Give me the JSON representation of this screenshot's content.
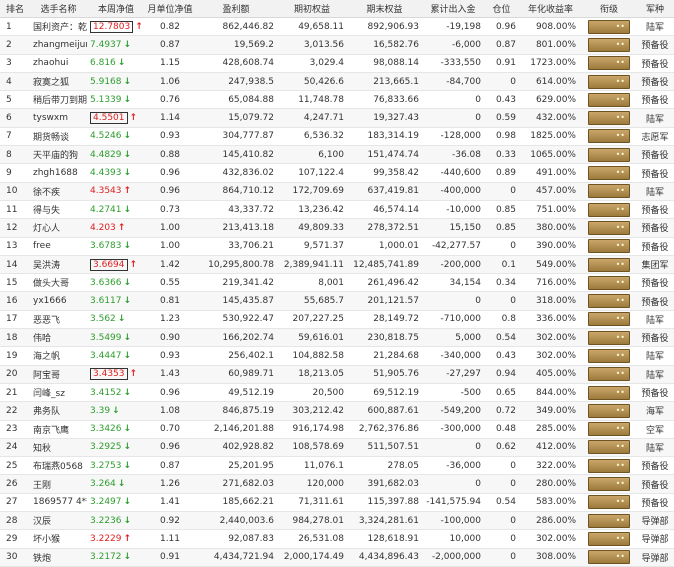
{
  "columns": [
    "排名",
    "选手名称",
    "本周净值",
    "月单位净值",
    "盈利额",
    "期初权益",
    "期末权益",
    "累计出入金",
    "仓位",
    "年化收益率",
    "衔级",
    "军种"
  ],
  "rows": [
    {
      "rank": "1",
      "name": "国利资产：乾势为王",
      "nav": "12.7803",
      "dir": "up",
      "box": true,
      "unit": "0.82",
      "profit": "862,446.82",
      "start": "49,658.11",
      "end": "892,906.93",
      "flow": "-19,198",
      "pos": "0.96",
      "annual": "908.00%",
      "branch": "陆军"
    },
    {
      "rank": "2",
      "name": "zhangmeijun",
      "nav": "7.4937",
      "dir": "down",
      "box": false,
      "unit": "0.87",
      "profit": "19,569.2",
      "start": "3,013.56",
      "end": "16,582.76",
      "flow": "-6,000",
      "pos": "0.87",
      "annual": "801.00%",
      "branch": "预备役"
    },
    {
      "rank": "3",
      "name": "zhaohui",
      "nav": "6.816",
      "dir": "down",
      "box": false,
      "unit": "1.15",
      "profit": "428,608.74",
      "start": "3,029.4",
      "end": "98,088.14",
      "flow": "-333,550",
      "pos": "0.91",
      "annual": "1723.00%",
      "branch": "预备役"
    },
    {
      "rank": "4",
      "name": "寂寞之狐",
      "nav": "5.9168",
      "dir": "down",
      "box": false,
      "unit": "1.06",
      "profit": "247,938.5",
      "start": "50,426.6",
      "end": "213,665.1",
      "flow": "-84,700",
      "pos": "0",
      "annual": "614.00%",
      "branch": "预备役"
    },
    {
      "rank": "5",
      "name": "稍后带刀到期",
      "nav": "5.1339",
      "dir": "down",
      "box": false,
      "unit": "0.76",
      "profit": "65,084.88",
      "start": "11,748.78",
      "end": "76,833.66",
      "flow": "0",
      "pos": "0.43",
      "annual": "629.00%",
      "branch": "预备役"
    },
    {
      "rank": "6",
      "name": "tyswxm",
      "nav": "4.5501",
      "dir": "up",
      "box": true,
      "unit": "1.14",
      "profit": "15,079.72",
      "start": "4,247.71",
      "end": "19,327.43",
      "flow": "0",
      "pos": "0.59",
      "annual": "432.00%",
      "branch": "陆军"
    },
    {
      "rank": "7",
      "name": "期货畅谈",
      "nav": "4.5246",
      "dir": "down",
      "box": false,
      "unit": "0.93",
      "profit": "304,777.87",
      "start": "6,536.32",
      "end": "183,314.19",
      "flow": "-128,000",
      "pos": "0.98",
      "annual": "1825.00%",
      "branch": "志愿军"
    },
    {
      "rank": "8",
      "name": "天平庙的狗",
      "nav": "4.4829",
      "dir": "down",
      "box": false,
      "unit": "0.88",
      "profit": "145,410.82",
      "start": "6,100",
      "end": "151,474.74",
      "flow": "-36.08",
      "pos": "0.33",
      "annual": "1065.00%",
      "branch": "预备役"
    },
    {
      "rank": "9",
      "name": "zhgh1688",
      "nav": "4.4393",
      "dir": "down",
      "box": false,
      "unit": "0.96",
      "profit": "432,836.02",
      "start": "107,122.4",
      "end": "99,358.42",
      "flow": "-440,600",
      "pos": "0.89",
      "annual": "491.00%",
      "branch": "预备役"
    },
    {
      "rank": "10",
      "name": "徐不疾",
      "nav": "4.3543",
      "dir": "up",
      "box": false,
      "unit": "0.96",
      "profit": "864,710.12",
      "start": "172,709.69",
      "end": "637,419.81",
      "flow": "-400,000",
      "pos": "0",
      "annual": "457.00%",
      "branch": "陆军"
    },
    {
      "rank": "11",
      "name": "得与失",
      "nav": "4.2741",
      "dir": "down",
      "box": false,
      "unit": "0.73",
      "profit": "43,337.72",
      "start": "13,236.42",
      "end": "46,574.14",
      "flow": "-10,000",
      "pos": "0.85",
      "annual": "751.00%",
      "branch": "预备役"
    },
    {
      "rank": "12",
      "name": "灯心人",
      "nav": "4.203",
      "dir": "up",
      "box": false,
      "unit": "1.00",
      "profit": "213,413.18",
      "start": "49,809.33",
      "end": "278,372.51",
      "flow": "15,150",
      "pos": "0.85",
      "annual": "380.00%",
      "branch": "预备役"
    },
    {
      "rank": "13",
      "name": "free",
      "nav": "3.6783",
      "dir": "down",
      "box": false,
      "unit": "1.00",
      "profit": "33,706.21",
      "start": "9,571.37",
      "end": "1,000.01",
      "flow": "-42,277.57",
      "pos": "0",
      "annual": "390.00%",
      "branch": "预备役"
    },
    {
      "rank": "14",
      "name": "吴洪涛",
      "nav": "3.6694",
      "dir": "up",
      "box": true,
      "unit": "1.42",
      "profit": "10,295,800.78",
      "start": "2,389,941.11",
      "end": "12,485,741.89",
      "flow": "-200,000",
      "pos": "0.1",
      "annual": "549.00%",
      "branch": "集团军"
    },
    {
      "rank": "15",
      "name": "做头大哥",
      "nav": "3.6366",
      "dir": "down",
      "box": false,
      "unit": "0.55",
      "profit": "219,341.42",
      "start": "8,001",
      "end": "261,496.42",
      "flow": "34,154",
      "pos": "0.34",
      "annual": "716.00%",
      "branch": "预备役"
    },
    {
      "rank": "16",
      "name": "yx1666",
      "nav": "3.6117",
      "dir": "down",
      "box": false,
      "unit": "0.81",
      "profit": "145,435.87",
      "start": "55,685.7",
      "end": "201,121.57",
      "flow": "0",
      "pos": "0",
      "annual": "318.00%",
      "branch": "预备役"
    },
    {
      "rank": "17",
      "name": "恶恶飞",
      "nav": "3.562",
      "dir": "down",
      "box": false,
      "unit": "1.23",
      "profit": "530,922.47",
      "start": "207,227.25",
      "end": "28,149.72",
      "flow": "-710,000",
      "pos": "0.8",
      "annual": "336.00%",
      "branch": "陆军"
    },
    {
      "rank": "18",
      "name": "伟哈",
      "nav": "3.5499",
      "dir": "down",
      "box": false,
      "unit": "0.90",
      "profit": "166,202.74",
      "start": "59,616.01",
      "end": "230,818.75",
      "flow": "5,000",
      "pos": "0.54",
      "annual": "302.00%",
      "branch": "预备役"
    },
    {
      "rank": "19",
      "name": "海之帆",
      "nav": "3.4447",
      "dir": "down",
      "box": false,
      "unit": "0.93",
      "profit": "256,402.1",
      "start": "104,882.58",
      "end": "21,284.68",
      "flow": "-340,000",
      "pos": "0.43",
      "annual": "302.00%",
      "branch": "陆军"
    },
    {
      "rank": "20",
      "name": "阿宝哥",
      "nav": "3.4353",
      "dir": "up",
      "box": true,
      "unit": "1.43",
      "profit": "60,989.71",
      "start": "18,213.05",
      "end": "51,905.76",
      "flow": "-27,297",
      "pos": "0.94",
      "annual": "405.00%",
      "branch": "陆军"
    },
    {
      "rank": "21",
      "name": "闫峰_sz",
      "nav": "3.4152",
      "dir": "down",
      "box": false,
      "unit": "0.96",
      "profit": "49,512.19",
      "start": "20,500",
      "end": "69,512.19",
      "flow": "-500",
      "pos": "0.65",
      "annual": "844.00%",
      "branch": "预备役"
    },
    {
      "rank": "22",
      "name": "弗务队",
      "nav": "3.39",
      "dir": "down",
      "box": false,
      "unit": "1.08",
      "profit": "846,875.19",
      "start": "303,212.42",
      "end": "600,887.61",
      "flow": "-549,200",
      "pos": "0.72",
      "annual": "349.00%",
      "branch": "海军"
    },
    {
      "rank": "23",
      "name": "南京飞鹰",
      "nav": "3.3426",
      "dir": "down",
      "box": false,
      "unit": "0.70",
      "profit": "2,146,201.88",
      "start": "916,174.98",
      "end": "2,762,376.86",
      "flow": "-300,000",
      "pos": "0.48",
      "annual": "285.00%",
      "branch": "空军"
    },
    {
      "rank": "24",
      "name": "知秋",
      "nav": "3.2925",
      "dir": "down",
      "box": false,
      "unit": "0.96",
      "profit": "402,928.82",
      "start": "108,578.69",
      "end": "511,507.51",
      "flow": "0",
      "pos": "0.62",
      "annual": "412.00%",
      "branch": "陆军"
    },
    {
      "rank": "25",
      "name": "布瑞燕0568",
      "nav": "3.2753",
      "dir": "down",
      "box": false,
      "unit": "0.87",
      "profit": "25,201.95",
      "start": "11,076.1",
      "end": "278.05",
      "flow": "-36,000",
      "pos": "0",
      "annual": "322.00%",
      "branch": "预备役"
    },
    {
      "rank": "26",
      "name": "王刚",
      "nav": "3.264",
      "dir": "down",
      "box": false,
      "unit": "1.26",
      "profit": "271,682.03",
      "start": "120,000",
      "end": "391,682.03",
      "flow": "0",
      "pos": "0",
      "annual": "280.00%",
      "branch": "预备役"
    },
    {
      "rank": "27",
      "name": "1869577 4***",
      "nav": "3.2497",
      "dir": "down",
      "box": false,
      "unit": "1.41",
      "profit": "185,662.21",
      "start": "71,311.61",
      "end": "115,397.88",
      "flow": "-141,575.94",
      "pos": "0.54",
      "annual": "583.00%",
      "branch": "预备役"
    },
    {
      "rank": "28",
      "name": "汉辰",
      "nav": "3.2236",
      "dir": "down",
      "box": false,
      "unit": "0.92",
      "profit": "2,440,003.6",
      "start": "984,278.01",
      "end": "3,324,281.61",
      "flow": "-100,000",
      "pos": "0",
      "annual": "286.00%",
      "branch": "导弹部"
    },
    {
      "rank": "29",
      "name": "坏小猴",
      "nav": "3.2229",
      "dir": "up",
      "box": false,
      "unit": "1.11",
      "profit": "92,087.83",
      "start": "26,531.08",
      "end": "128,618.91",
      "flow": "10,000",
      "pos": "0",
      "annual": "302.00%",
      "branch": "导弹部"
    },
    {
      "rank": "30",
      "name": "铁炮",
      "nav": "3.2172",
      "dir": "down",
      "box": false,
      "unit": "0.91",
      "profit": "4,434,721.94",
      "start": "2,000,174.49",
      "end": "4,434,896.43",
      "flow": "-2,000,000",
      "pos": "0",
      "annual": "308.00%",
      "branch": "导弹部"
    }
  ]
}
